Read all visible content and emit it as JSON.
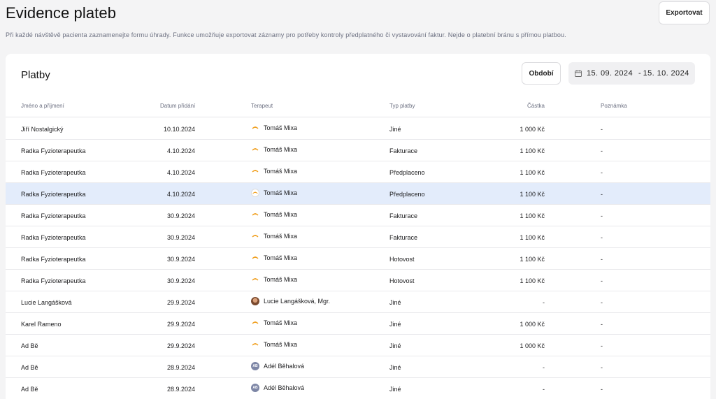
{
  "header": {
    "title": "Evidence plateb",
    "export_label": "Exportovat",
    "description": "Při každé návštěvě pacienta zaznamenejte formu úhrady. Funkce umožňuje exportovat záznamy pro potřeby kontroly předplatného či vystavování faktur. Nejde o platební bránu s přímou platbou."
  },
  "card": {
    "title": "Platby",
    "period_label": "Období",
    "date_from": "15. 09. 2024",
    "date_sep": "-",
    "date_to": "15. 10. 2024"
  },
  "table": {
    "columns": [
      "Jméno a příjmení",
      "Datum přidání",
      "Terapeut",
      "Typ platby",
      "Částka",
      "Poznámka"
    ],
    "rows": [
      {
        "name": "Jiří Nostalgický",
        "date": "10.10.2024",
        "therapist": "Tomáš Mixa",
        "avatar": "logo",
        "type": "Jiné",
        "amount": "1 000 Kč",
        "note": "-"
      },
      {
        "name": "Radka Fyzioterapeutka",
        "date": "4.10.2024",
        "therapist": "Tomáš Mixa",
        "avatar": "logo",
        "type": "Fakturace",
        "amount": "1 100 Kč",
        "note": "-"
      },
      {
        "name": "Radka Fyzioterapeutka",
        "date": "4.10.2024",
        "therapist": "Tomáš Mixa",
        "avatar": "logo",
        "type": "Předplaceno",
        "amount": "1 100 Kč",
        "note": "-"
      },
      {
        "name": "Radka Fyzioterapeutka",
        "date": "4.10.2024",
        "therapist": "Tomáš Mixa",
        "avatar": "logo-ring",
        "type": "Předplaceno",
        "amount": "1 100 Kč",
        "note": "-",
        "selected": true
      },
      {
        "name": "Radka Fyzioterapeutka",
        "date": "30.9.2024",
        "therapist": "Tomáš Mixa",
        "avatar": "logo",
        "type": "Fakturace",
        "amount": "1 100 Kč",
        "note": "-"
      },
      {
        "name": "Radka Fyzioterapeutka",
        "date": "30.9.2024",
        "therapist": "Tomáš Mixa",
        "avatar": "logo",
        "type": "Fakturace",
        "amount": "1 100 Kč",
        "note": "-"
      },
      {
        "name": "Radka Fyzioterapeutka",
        "date": "30.9.2024",
        "therapist": "Tomáš Mixa",
        "avatar": "logo",
        "type": "Hotovost",
        "amount": "1 100 Kč",
        "note": "-"
      },
      {
        "name": "Radka Fyzioterapeutka",
        "date": "30.9.2024",
        "therapist": "Tomáš Mixa",
        "avatar": "logo",
        "type": "Hotovost",
        "amount": "1 100 Kč",
        "note": "-"
      },
      {
        "name": "Lucie Langášková",
        "date": "29.9.2024",
        "therapist": "Lucie Langášková, Mgr.",
        "avatar": "photo",
        "type": "Jiné",
        "amount": "-",
        "note": "-"
      },
      {
        "name": "Karel  Rameno",
        "date": "29.9.2024",
        "therapist": "Tomáš Mixa",
        "avatar": "logo",
        "type": "Jiné",
        "amount": "1 000 Kč",
        "note": "-"
      },
      {
        "name": "Ad Bě",
        "date": "29.9.2024",
        "therapist": "Tomáš Mixa",
        "avatar": "logo",
        "type": "Jiné",
        "amount": "1 000 Kč",
        "note": "-"
      },
      {
        "name": "Ad Bě",
        "date": "28.9.2024",
        "therapist": "Adél Běhalová",
        "avatar": "initials",
        "initials": "AB",
        "type": "Jiné",
        "amount": "-",
        "note": "-"
      },
      {
        "name": "Ad Bě",
        "date": "28.9.2024",
        "therapist": "Adél Běhalová",
        "avatar": "initials",
        "initials": "AB",
        "type": "Jiné",
        "amount": "-",
        "note": "-"
      }
    ]
  },
  "colors": {
    "selected_row": "#e3ecfb",
    "logo_accent": "#f0a020"
  }
}
